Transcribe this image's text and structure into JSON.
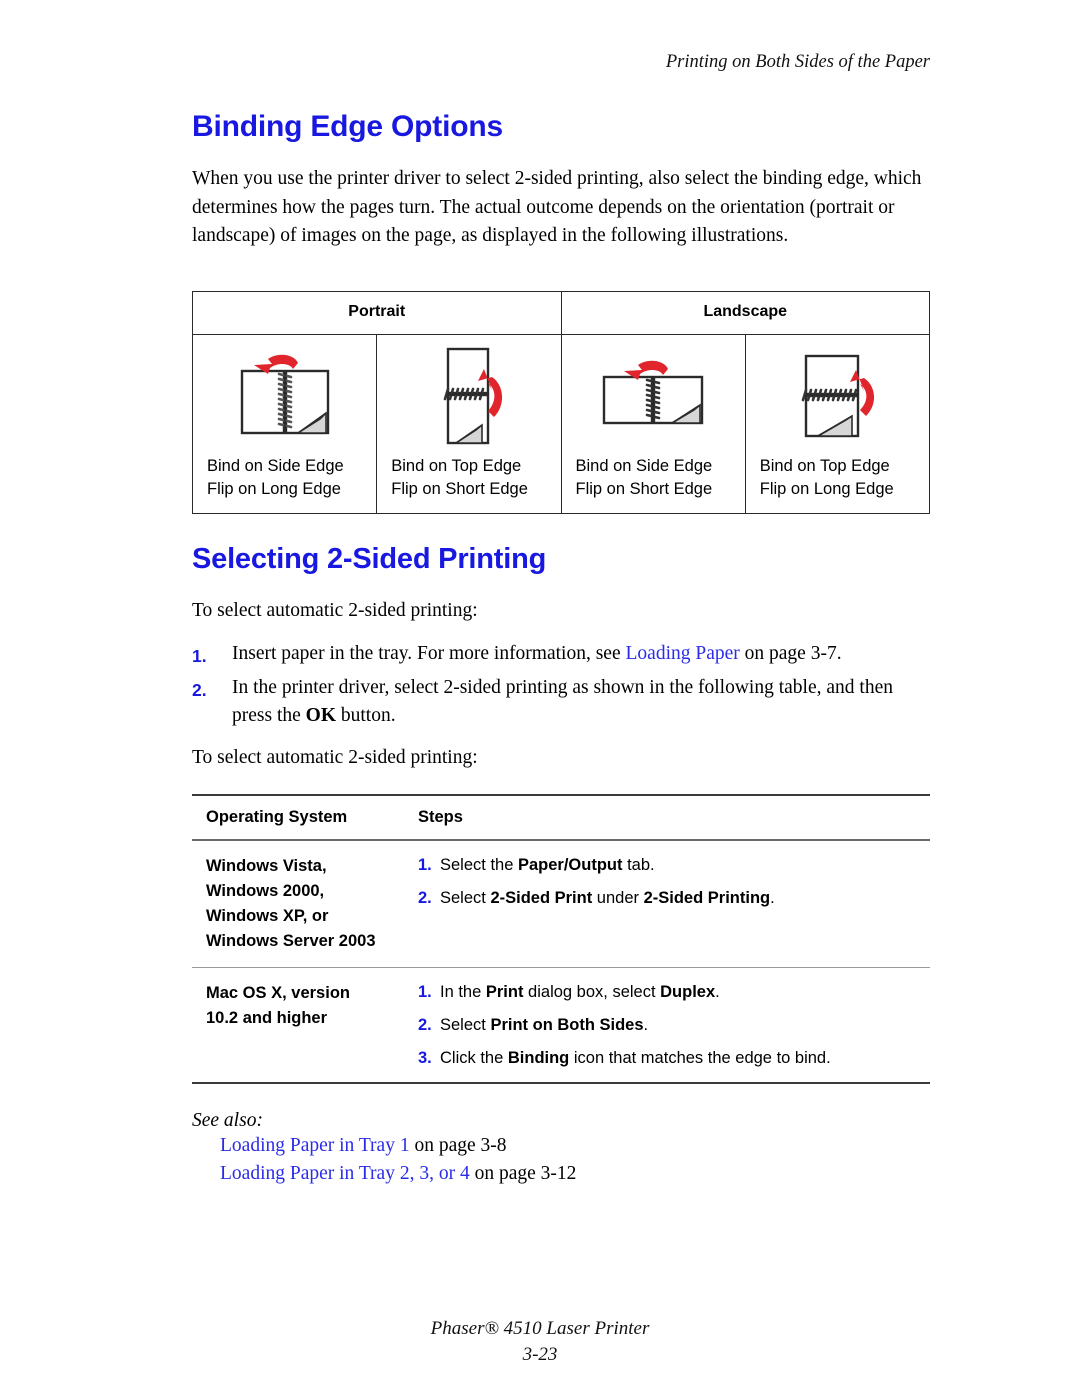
{
  "header": {
    "running_title": "Printing on Both Sides of the Paper"
  },
  "section1": {
    "heading": "Binding Edge Options",
    "intro": "When you use the printer driver to select 2-sided printing, also select the binding edge, which determines how the pages turn. The actual outcome depends on the orientation (portrait or landscape) of images on the page, as displayed in the following illustrations."
  },
  "illustration_table": {
    "group_headers": [
      "Portrait",
      "Landscape"
    ],
    "columns": [
      {
        "icon": "book-side-bound-landscape-spread-icon",
        "orientation": "portrait",
        "bind_line": "Bind on Side Edge",
        "flip_line": "Flip on Long Edge"
      },
      {
        "icon": "book-top-bound-portrait-icon",
        "orientation": "portrait",
        "bind_line": "Bind on Top Edge",
        "flip_line": "Flip on Short Edge"
      },
      {
        "icon": "book-side-bound-wide-spread-icon",
        "orientation": "landscape",
        "bind_line": "Bind on Side Edge",
        "flip_line": "Flip on Short Edge"
      },
      {
        "icon": "book-top-bound-wide-icon",
        "orientation": "landscape",
        "bind_line": "Bind on Top Edge",
        "flip_line": "Flip on Long Edge"
      }
    ]
  },
  "section2": {
    "heading": "Selecting 2-Sided Printing",
    "lead_in": "To select automatic 2-sided printing:",
    "steps": [
      {
        "num": "1.",
        "prefix": "Insert paper in the tray. For more information, see ",
        "link": "Loading Paper",
        "suffix": " on page 3-7."
      },
      {
        "num": "2.",
        "prefix": "In the printer driver, select 2-sided printing as shown in the following table, and then press the ",
        "bold": "OK",
        "suffix": " button."
      }
    ],
    "lead_in2": "To select automatic 2-sided printing:"
  },
  "os_table": {
    "headers": [
      "Operating System",
      "Steps"
    ],
    "rows": [
      {
        "os": [
          "Windows Vista,",
          "Windows 2000,",
          "Windows XP, or",
          "Windows Server 2003"
        ],
        "steps": [
          {
            "num": "1.",
            "parts": [
              {
                "t": "Select the ",
                "b": false
              },
              {
                "t": "Paper/Output",
                "b": true
              },
              {
                "t": " tab.",
                "b": false
              }
            ]
          },
          {
            "num": "2.",
            "parts": [
              {
                "t": "Select ",
                "b": false
              },
              {
                "t": "2-Sided Print",
                "b": true
              },
              {
                "t": " under ",
                "b": false
              },
              {
                "t": "2-Sided Printing",
                "b": true
              },
              {
                "t": ".",
                "b": false
              }
            ]
          }
        ]
      },
      {
        "os": [
          "Mac OS X, version",
          "10.2 and higher"
        ],
        "steps": [
          {
            "num": "1.",
            "parts": [
              {
                "t": "In the ",
                "b": false
              },
              {
                "t": "Print",
                "b": true
              },
              {
                "t": " dialog box, select ",
                "b": false
              },
              {
                "t": "Duplex",
                "b": true
              },
              {
                "t": ".",
                "b": false
              }
            ]
          },
          {
            "num": "2.",
            "parts": [
              {
                "t": "Select ",
                "b": false
              },
              {
                "t": "Print on Both Sides",
                "b": true
              },
              {
                "t": ".",
                "b": false
              }
            ]
          },
          {
            "num": "3.",
            "parts": [
              {
                "t": "Click the ",
                "b": false
              },
              {
                "t": "Binding",
                "b": true
              },
              {
                "t": " icon that matches the edge to bind.",
                "b": false
              }
            ]
          }
        ]
      }
    ]
  },
  "see_also": {
    "label": "See also:",
    "entries": [
      {
        "link": "Loading Paper in Tray 1",
        "suffix": " on page 3-8"
      },
      {
        "link": "Loading Paper in Tray 2, 3, or 4",
        "suffix": " on page 3-12"
      }
    ]
  },
  "footer": {
    "product": "Phaser® 4510 Laser Printer",
    "page_number": "3-23"
  },
  "colors": {
    "heading_blue": "#1818E0",
    "link_blue": "#2b2bE8",
    "arrow_red": "#E0262C",
    "rule_dark": "#3a3a3a",
    "page_curl_gray": "#d6d6d6"
  }
}
